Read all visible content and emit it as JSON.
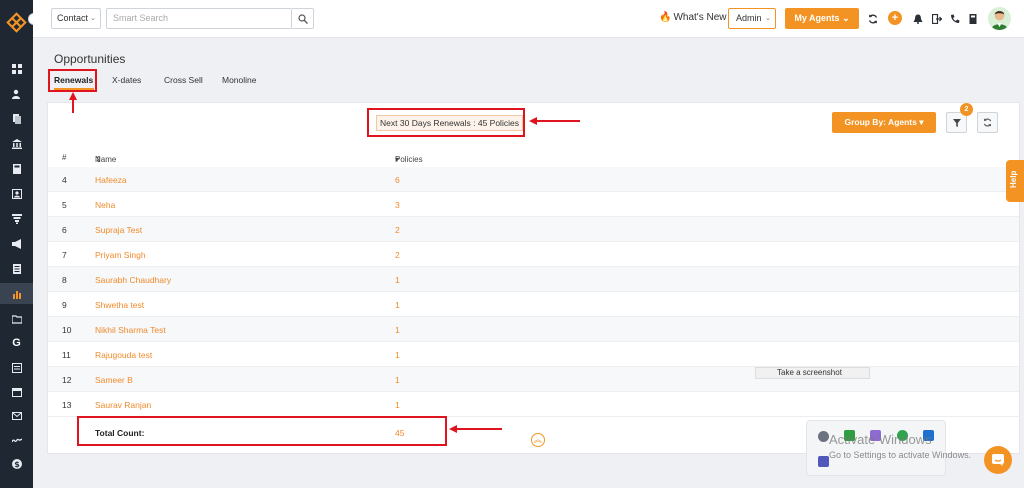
{
  "topbar": {
    "contact_select": "Contact",
    "search_placeholder": "Smart Search",
    "whats_new": "What's New",
    "role_select": "Admin",
    "agents_button": "My Agents"
  },
  "page": {
    "title": "Opportunities",
    "tabs": [
      {
        "label": "Renewals",
        "active": true
      },
      {
        "label": "X-dates",
        "active": false
      },
      {
        "label": "Cross Sell",
        "active": false
      },
      {
        "label": "Monoline",
        "active": false
      }
    ]
  },
  "card": {
    "summary": "Next 30 Days Renewals : 45 Policies",
    "group_by": "Group By: Agents",
    "filter_badge": "2",
    "columns": {
      "num": "#",
      "name": "Name",
      "policies": "Policies"
    },
    "rows": [
      {
        "num": "4",
        "name": "Hafeeza",
        "policies": "6"
      },
      {
        "num": "5",
        "name": "Neha",
        "policies": "3"
      },
      {
        "num": "6",
        "name": "Supraja Test",
        "policies": "2"
      },
      {
        "num": "7",
        "name": "Priyam Singh",
        "policies": "2"
      },
      {
        "num": "8",
        "name": "Saurabh Chaudhary",
        "policies": "1"
      },
      {
        "num": "9",
        "name": "Shwetha test",
        "policies": "1"
      },
      {
        "num": "10",
        "name": "Nikhil Sharma Test",
        "policies": "1"
      },
      {
        "num": "11",
        "name": "Rajugouda test",
        "policies": "1"
      },
      {
        "num": "12",
        "name": "Sameer B",
        "policies": "1"
      },
      {
        "num": "13",
        "name": "Saurav Ranjan",
        "policies": "1"
      }
    ],
    "total_label": "Total Count:",
    "total_value": "45"
  },
  "overlay": {
    "help": "Help",
    "screenshot_tooltip": "Take a screenshot",
    "activate_title": "Activate Windows",
    "activate_sub": "Go to Settings to activate Windows."
  },
  "colors": {
    "accent": "#f39323",
    "link": "#f08a2a",
    "annotation": "#e0141e",
    "rail": "#1f2733"
  }
}
